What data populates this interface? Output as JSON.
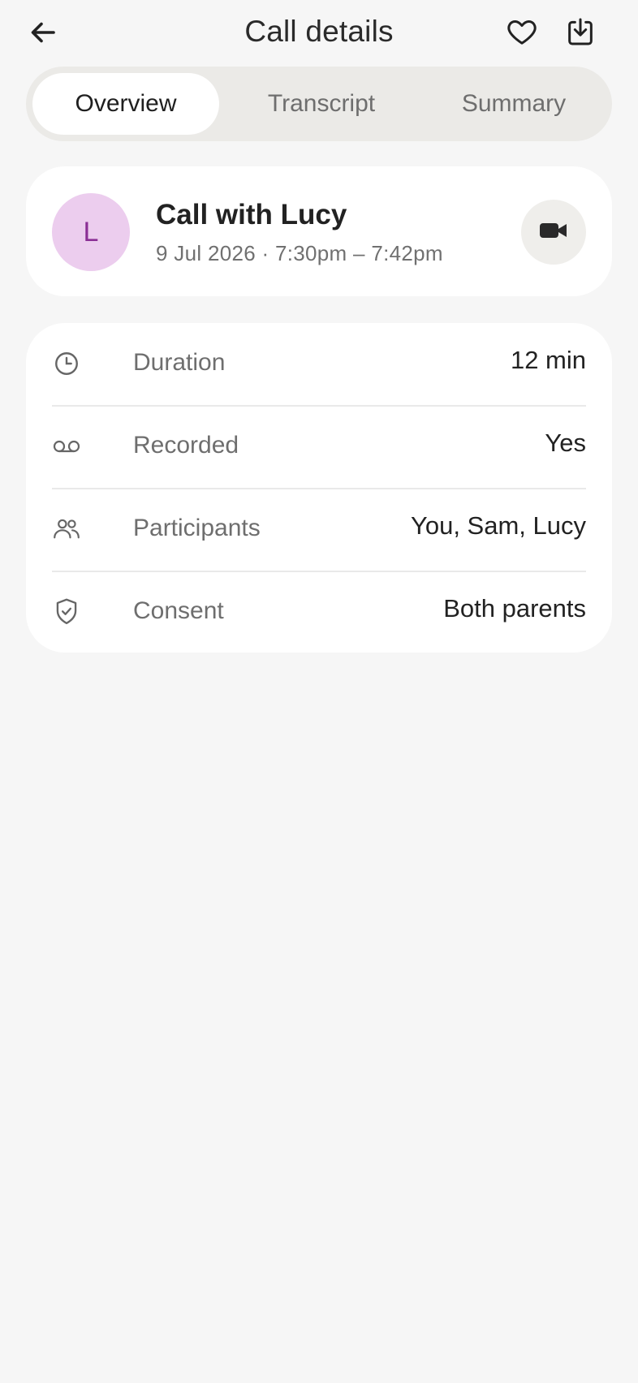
{
  "header": {
    "title": "Call details",
    "back_icon": "arrow-left-icon",
    "favorite_icon": "heart-icon",
    "download_icon": "download-icon"
  },
  "tabs": [
    {
      "label": "Overview",
      "active": true
    },
    {
      "label": "Transcript",
      "active": false
    },
    {
      "label": "Summary",
      "active": false
    }
  ],
  "call": {
    "avatar_initial": "L",
    "title": "Call with Lucy",
    "time": "9 Jul 2026 · 7:30pm – 7:42pm",
    "video_icon": "video-camera-icon"
  },
  "details": [
    {
      "icon": "clock-icon",
      "label": "Duration",
      "value": "12 min"
    },
    {
      "icon": "voicemail-icon",
      "label": "Recorded",
      "value": "Yes"
    },
    {
      "icon": "users-icon",
      "label": "Participants",
      "value": "You, Sam, Lucy"
    },
    {
      "icon": "shield-check-icon",
      "label": "Consent",
      "value": "Both parents"
    }
  ],
  "colors": {
    "background": "#f6f6f6",
    "avatar_bg": "#eccdee",
    "avatar_text": "#8b2f95",
    "tab_track": "#ebeae7"
  }
}
